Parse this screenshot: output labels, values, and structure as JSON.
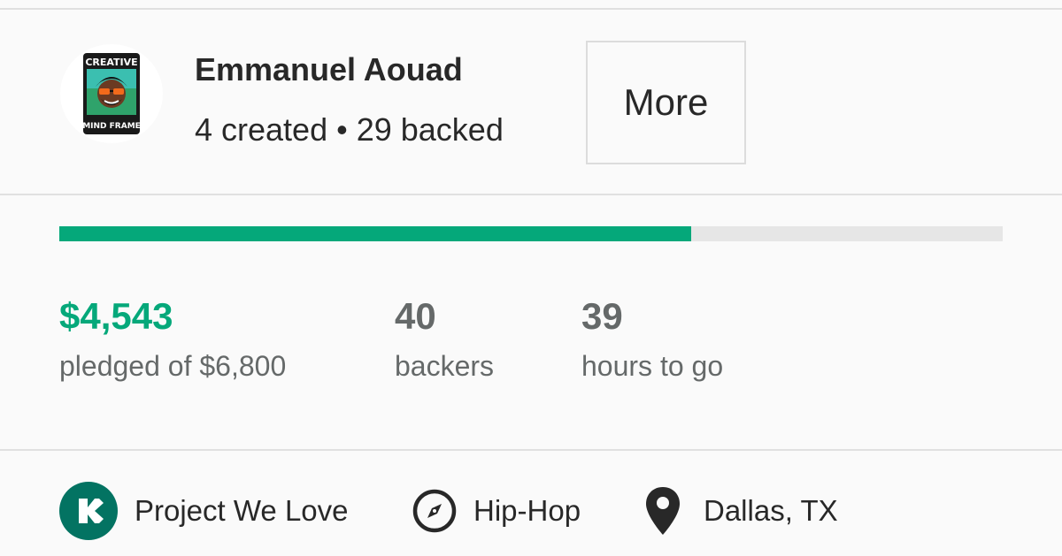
{
  "creator": {
    "name": "Emmanuel Aouad",
    "stats": "4 created • 29 backed",
    "avatar_icon": "creative-mind-frame-avatar-icon",
    "avatar_text_top": "CREATIVE",
    "avatar_text_bottom": "MIND FRAME",
    "more_label": "More"
  },
  "funding": {
    "progress_fraction": 0.67,
    "pledged_value": "$4,543",
    "pledged_label": "pledged of $6,800",
    "backers_value": "40",
    "backers_label": "backers",
    "time_value": "39",
    "time_label": "hours to go"
  },
  "tags": {
    "badge": {
      "icon": "kickstarter-k-icon",
      "label": "Project We Love"
    },
    "category": {
      "icon": "compass-icon",
      "label": "Hip-Hop"
    },
    "location": {
      "icon": "map-pin-icon",
      "label": "Dallas, TX"
    }
  },
  "colors": {
    "accent": "#05a87a",
    "text_dark": "#282828",
    "text_muted": "#656969",
    "divider": "#e0e0e0",
    "track": "#e6e6e6",
    "badge_green": "#037362"
  }
}
